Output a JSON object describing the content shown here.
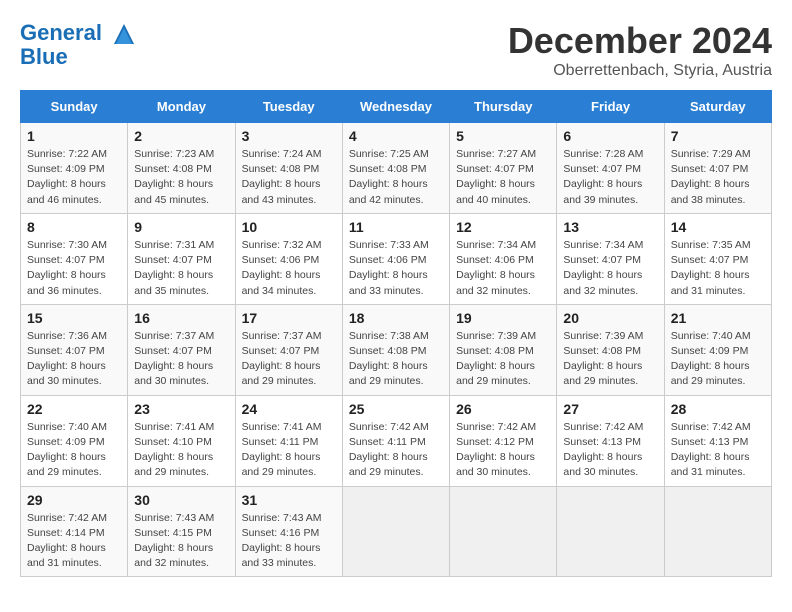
{
  "header": {
    "logo_line1": "General",
    "logo_line2": "Blue",
    "month": "December 2024",
    "location": "Oberrettenbach, Styria, Austria"
  },
  "weekdays": [
    "Sunday",
    "Monday",
    "Tuesday",
    "Wednesday",
    "Thursday",
    "Friday",
    "Saturday"
  ],
  "weeks": [
    [
      {
        "day": "1",
        "detail": "Sunrise: 7:22 AM\nSunset: 4:09 PM\nDaylight: 8 hours\nand 46 minutes."
      },
      {
        "day": "2",
        "detail": "Sunrise: 7:23 AM\nSunset: 4:08 PM\nDaylight: 8 hours\nand 45 minutes."
      },
      {
        "day": "3",
        "detail": "Sunrise: 7:24 AM\nSunset: 4:08 PM\nDaylight: 8 hours\nand 43 minutes."
      },
      {
        "day": "4",
        "detail": "Sunrise: 7:25 AM\nSunset: 4:08 PM\nDaylight: 8 hours\nand 42 minutes."
      },
      {
        "day": "5",
        "detail": "Sunrise: 7:27 AM\nSunset: 4:07 PM\nDaylight: 8 hours\nand 40 minutes."
      },
      {
        "day": "6",
        "detail": "Sunrise: 7:28 AM\nSunset: 4:07 PM\nDaylight: 8 hours\nand 39 minutes."
      },
      {
        "day": "7",
        "detail": "Sunrise: 7:29 AM\nSunset: 4:07 PM\nDaylight: 8 hours\nand 38 minutes."
      }
    ],
    [
      {
        "day": "8",
        "detail": "Sunrise: 7:30 AM\nSunset: 4:07 PM\nDaylight: 8 hours\nand 36 minutes."
      },
      {
        "day": "9",
        "detail": "Sunrise: 7:31 AM\nSunset: 4:07 PM\nDaylight: 8 hours\nand 35 minutes."
      },
      {
        "day": "10",
        "detail": "Sunrise: 7:32 AM\nSunset: 4:06 PM\nDaylight: 8 hours\nand 34 minutes."
      },
      {
        "day": "11",
        "detail": "Sunrise: 7:33 AM\nSunset: 4:06 PM\nDaylight: 8 hours\nand 33 minutes."
      },
      {
        "day": "12",
        "detail": "Sunrise: 7:34 AM\nSunset: 4:06 PM\nDaylight: 8 hours\nand 32 minutes."
      },
      {
        "day": "13",
        "detail": "Sunrise: 7:34 AM\nSunset: 4:07 PM\nDaylight: 8 hours\nand 32 minutes."
      },
      {
        "day": "14",
        "detail": "Sunrise: 7:35 AM\nSunset: 4:07 PM\nDaylight: 8 hours\nand 31 minutes."
      }
    ],
    [
      {
        "day": "15",
        "detail": "Sunrise: 7:36 AM\nSunset: 4:07 PM\nDaylight: 8 hours\nand 30 minutes."
      },
      {
        "day": "16",
        "detail": "Sunrise: 7:37 AM\nSunset: 4:07 PM\nDaylight: 8 hours\nand 30 minutes."
      },
      {
        "day": "17",
        "detail": "Sunrise: 7:37 AM\nSunset: 4:07 PM\nDaylight: 8 hours\nand 29 minutes."
      },
      {
        "day": "18",
        "detail": "Sunrise: 7:38 AM\nSunset: 4:08 PM\nDaylight: 8 hours\nand 29 minutes."
      },
      {
        "day": "19",
        "detail": "Sunrise: 7:39 AM\nSunset: 4:08 PM\nDaylight: 8 hours\nand 29 minutes."
      },
      {
        "day": "20",
        "detail": "Sunrise: 7:39 AM\nSunset: 4:08 PM\nDaylight: 8 hours\nand 29 minutes."
      },
      {
        "day": "21",
        "detail": "Sunrise: 7:40 AM\nSunset: 4:09 PM\nDaylight: 8 hours\nand 29 minutes."
      }
    ],
    [
      {
        "day": "22",
        "detail": "Sunrise: 7:40 AM\nSunset: 4:09 PM\nDaylight: 8 hours\nand 29 minutes."
      },
      {
        "day": "23",
        "detail": "Sunrise: 7:41 AM\nSunset: 4:10 PM\nDaylight: 8 hours\nand 29 minutes."
      },
      {
        "day": "24",
        "detail": "Sunrise: 7:41 AM\nSunset: 4:11 PM\nDaylight: 8 hours\nand 29 minutes."
      },
      {
        "day": "25",
        "detail": "Sunrise: 7:42 AM\nSunset: 4:11 PM\nDaylight: 8 hours\nand 29 minutes."
      },
      {
        "day": "26",
        "detail": "Sunrise: 7:42 AM\nSunset: 4:12 PM\nDaylight: 8 hours\nand 30 minutes."
      },
      {
        "day": "27",
        "detail": "Sunrise: 7:42 AM\nSunset: 4:13 PM\nDaylight: 8 hours\nand 30 minutes."
      },
      {
        "day": "28",
        "detail": "Sunrise: 7:42 AM\nSunset: 4:13 PM\nDaylight: 8 hours\nand 31 minutes."
      }
    ],
    [
      {
        "day": "29",
        "detail": "Sunrise: 7:42 AM\nSunset: 4:14 PM\nDaylight: 8 hours\nand 31 minutes."
      },
      {
        "day": "30",
        "detail": "Sunrise: 7:43 AM\nSunset: 4:15 PM\nDaylight: 8 hours\nand 32 minutes."
      },
      {
        "day": "31",
        "detail": "Sunrise: 7:43 AM\nSunset: 4:16 PM\nDaylight: 8 hours\nand 33 minutes."
      },
      {
        "day": "",
        "detail": ""
      },
      {
        "day": "",
        "detail": ""
      },
      {
        "day": "",
        "detail": ""
      },
      {
        "day": "",
        "detail": ""
      }
    ]
  ]
}
